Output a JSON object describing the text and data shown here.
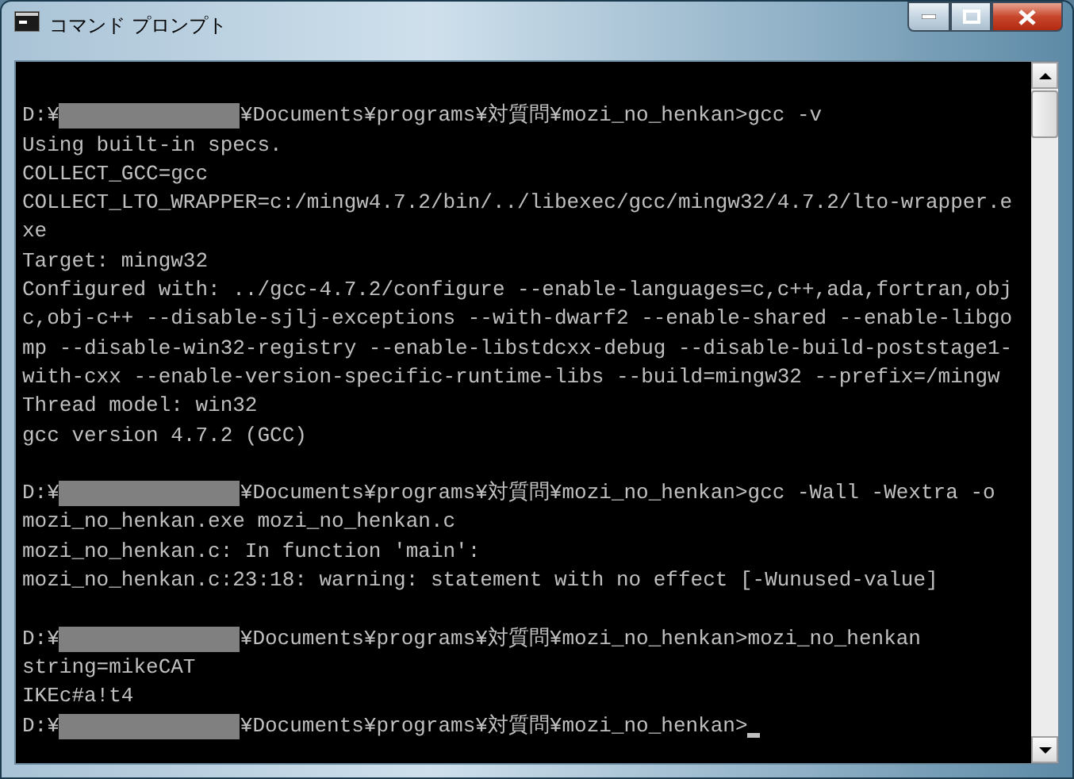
{
  "window": {
    "title": "コマンド プロンプト"
  },
  "console": {
    "lines": [
      {
        "kind": "blank"
      },
      {
        "kind": "prompt",
        "drive": "D:¥",
        "path": "¥Documents¥programs¥対質問¥mozi_no_henkan>",
        "command": "gcc -v",
        "cursor": false
      },
      {
        "kind": "text",
        "text": "Using built-in specs."
      },
      {
        "kind": "text",
        "text": "COLLECT_GCC=gcc"
      },
      {
        "kind": "text",
        "text": "COLLECT_LTO_WRAPPER=c:/mingw4.7.2/bin/../libexec/gcc/mingw32/4.7.2/lto-wrapper.e"
      },
      {
        "kind": "text",
        "text": "xe"
      },
      {
        "kind": "text",
        "text": "Target: mingw32"
      },
      {
        "kind": "text",
        "text": "Configured with: ../gcc-4.7.2/configure --enable-languages=c,c++,ada,fortran,obj"
      },
      {
        "kind": "text",
        "text": "c,obj-c++ --disable-sjlj-exceptions --with-dwarf2 --enable-shared --enable-libgo"
      },
      {
        "kind": "text",
        "text": "mp --disable-win32-registry --enable-libstdcxx-debug --disable-build-poststage1-"
      },
      {
        "kind": "text",
        "text": "with-cxx --enable-version-specific-runtime-libs --build=mingw32 --prefix=/mingw"
      },
      {
        "kind": "text",
        "text": "Thread model: win32"
      },
      {
        "kind": "text",
        "text": "gcc version 4.7.2 (GCC)"
      },
      {
        "kind": "blank"
      },
      {
        "kind": "prompt",
        "drive": "D:¥",
        "path": "¥Documents¥programs¥対質問¥mozi_no_henkan>",
        "command": "gcc -Wall -Wextra -o",
        "cursor": false
      },
      {
        "kind": "text",
        "text": "mozi_no_henkan.exe mozi_no_henkan.c"
      },
      {
        "kind": "text",
        "text": "mozi_no_henkan.c: In function 'main':"
      },
      {
        "kind": "text",
        "text": "mozi_no_henkan.c:23:18: warning: statement with no effect [-Wunused-value]"
      },
      {
        "kind": "blank"
      },
      {
        "kind": "prompt",
        "drive": "D:¥",
        "path": "¥Documents¥programs¥対質問¥mozi_no_henkan>",
        "command": "mozi_no_henkan",
        "cursor": false
      },
      {
        "kind": "text",
        "text": "string=mikeCAT"
      },
      {
        "kind": "text",
        "text": "IKEc#a!t4"
      },
      {
        "kind": "prompt",
        "drive": "D:¥",
        "path": "¥Documents¥programs¥対質問¥mozi_no_henkan>",
        "cursor": true
      }
    ]
  }
}
